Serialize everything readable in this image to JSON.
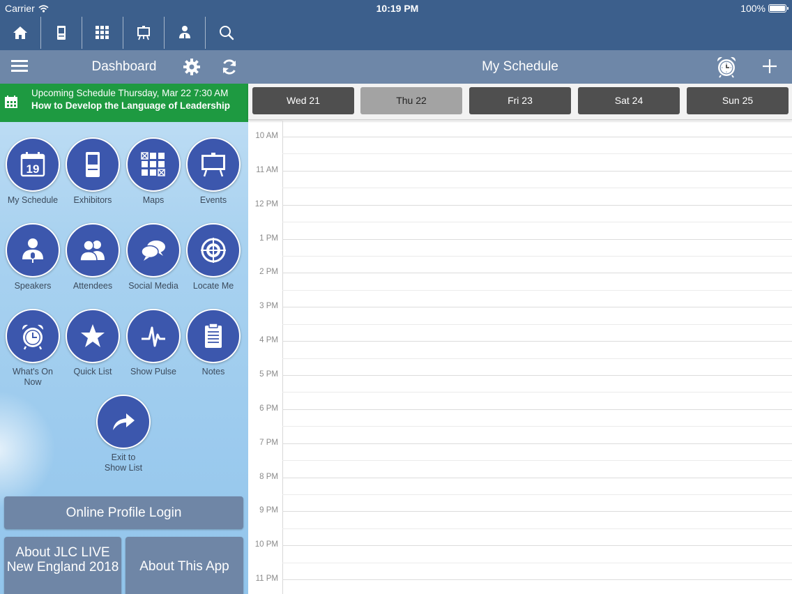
{
  "status_bar": {
    "carrier": "Carrier",
    "time": "10:19 PM",
    "battery": "100%"
  },
  "top_nav": {
    "icons": [
      "home-icon",
      "exhibitor-booth-icon",
      "map-grid-icon",
      "easel-icon",
      "speaker-icon",
      "search-icon"
    ]
  },
  "dashboard": {
    "title": "Dashboard"
  },
  "upcoming": {
    "line1": "Upcoming Schedule Thursday, Mar 22 7:30 AM",
    "line2": "How to Develop the Language of Leadership"
  },
  "tiles": [
    {
      "label": "My Schedule",
      "icon": "calendar-icon",
      "day": "19"
    },
    {
      "label": "Exhibitors",
      "icon": "exhibitor-booth-icon"
    },
    {
      "label": "Maps",
      "icon": "map-grid-icon"
    },
    {
      "label": "Events",
      "icon": "easel-icon"
    },
    {
      "label": "Speakers",
      "icon": "speaker-icon"
    },
    {
      "label": "Attendees",
      "icon": "attendees-icon"
    },
    {
      "label": "Social Media",
      "icon": "chat-bubbles-icon"
    },
    {
      "label": "Locate Me",
      "icon": "target-icon"
    },
    {
      "label": "What's On Now",
      "icon": "alarm-clock-icon"
    },
    {
      "label": "Quick List",
      "icon": "star-icon"
    },
    {
      "label": "Show Pulse",
      "icon": "pulse-icon"
    },
    {
      "label": "Notes",
      "icon": "clipboard-icon"
    },
    {
      "label": "Exit to Show List",
      "icon": "share-arrow-icon"
    }
  ],
  "buttons": {
    "profile": "Online Profile Login",
    "about_jlc": "About JLC LIVE New England 2018",
    "about_app": "About This App"
  },
  "schedule": {
    "title": "My Schedule",
    "days": [
      {
        "label": "Wed 21",
        "selected": false
      },
      {
        "label": "Thu 22",
        "selected": true
      },
      {
        "label": "Fri 23",
        "selected": false
      },
      {
        "label": "Sat 24",
        "selected": false
      },
      {
        "label": "Sun 25",
        "selected": false
      }
    ],
    "hours": [
      "10 AM",
      "11 AM",
      "12 PM",
      "1 PM",
      "2 PM",
      "3 PM",
      "4 PM",
      "5 PM",
      "6 PM",
      "7 PM",
      "8 PM",
      "9 PM",
      "10 PM",
      "11 PM"
    ]
  },
  "colors": {
    "nav_dark": "#3c5f8c",
    "bar": "#6e87a8",
    "upcoming_green": "#1e9a41",
    "tile_blue": "#3c57ad",
    "day_button": "#4f4f4f",
    "day_selected": "#a3a3a3"
  }
}
